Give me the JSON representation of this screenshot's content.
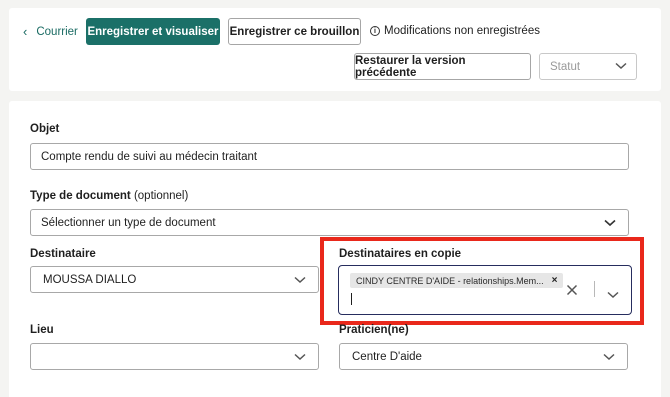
{
  "header": {
    "back_label": "Courrier",
    "save_view_label": "Enregistrer et visualiser",
    "save_draft_label": "Enregistrer ce brouillon",
    "unsaved_label": "Modifications non enregistrées",
    "restore_label": "Restaurer la version précédente",
    "status_placeholder": "Statut"
  },
  "form": {
    "subject": {
      "label": "Objet",
      "value": "Compte rendu de suivi au médecin traitant"
    },
    "doc_type": {
      "label": "Type de document",
      "optional": "(optionnel)",
      "value": "Sélectionner un type de document"
    },
    "recipient": {
      "label": "Destinataire",
      "value": "MOUSSA DIALLO"
    },
    "cc": {
      "label": "Destinataires en copie",
      "chip": "CINDY CENTRE D'AIDE - relationships.Mem..."
    },
    "place": {
      "label": "Lieu",
      "value": ""
    },
    "practitioner": {
      "label": "Praticien(ne)",
      "value": "Centre D'aide"
    }
  },
  "colors": {
    "primary": "#1b7068",
    "link": "#1a6b63",
    "highlight": "#e9281b",
    "focus_border": "#262d5e"
  },
  "icons": {
    "back": "chevron-left-icon",
    "info": "info-circle-icon",
    "dropdown": "chevron-down-icon",
    "clear": "close-icon",
    "chip_remove": "close-icon"
  }
}
